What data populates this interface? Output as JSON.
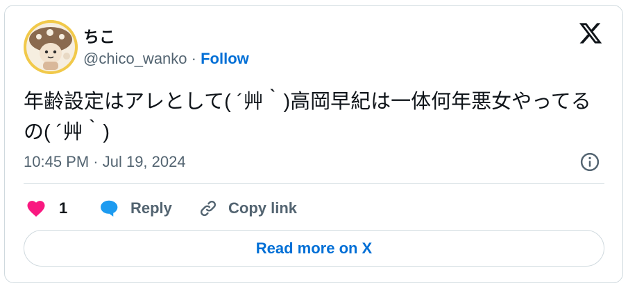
{
  "author": {
    "display_name": "ちこ",
    "handle": "@chico_wanko",
    "separator": "·",
    "follow_label": "Follow"
  },
  "tweet": {
    "text": "年齢設定はアレとして( ´艸｀)高岡早紀は一体何年悪女やってるの( ´艸｀)",
    "timestamp": "10:45 PM · Jul 19, 2024"
  },
  "actions": {
    "like_count": "1",
    "reply_label": "Reply",
    "copy_link_label": "Copy link"
  },
  "footer": {
    "read_more_label": "Read more on X"
  },
  "colors": {
    "accent": "#006fd6",
    "like": "#f91880",
    "reply": "#1d9bf0",
    "text": "#0f1419",
    "muted": "#536471",
    "border": "#cfd9de"
  },
  "icons": [
    "x-logo-icon",
    "info-icon",
    "heart-icon",
    "reply-bubble-icon",
    "link-icon"
  ]
}
